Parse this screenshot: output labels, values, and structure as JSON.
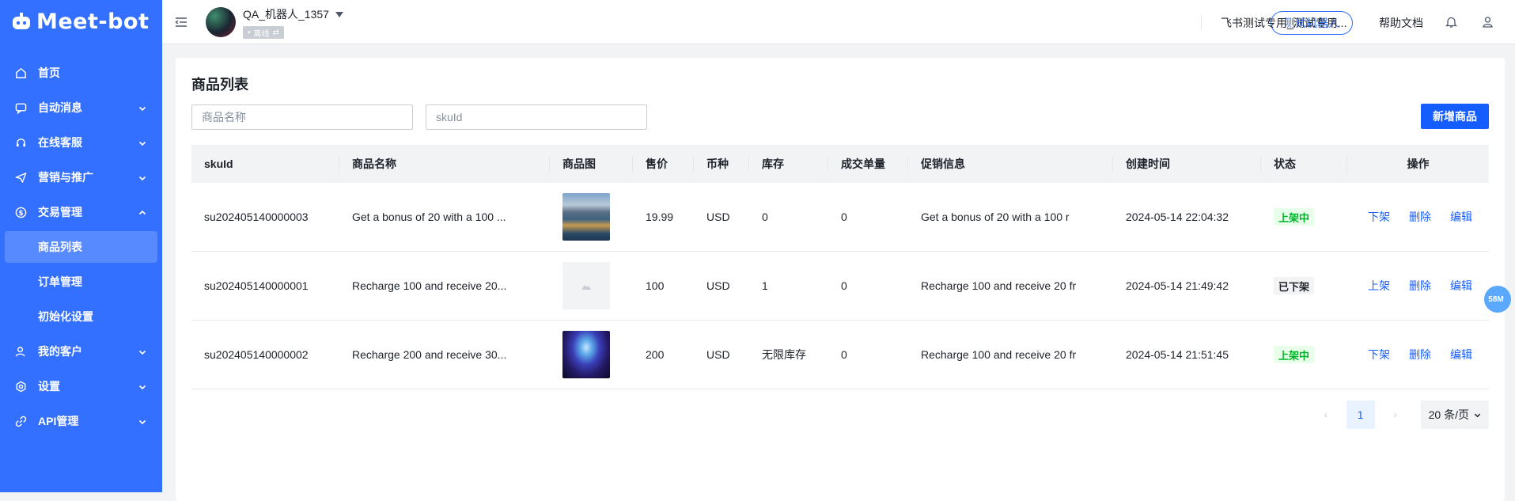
{
  "app": {
    "logo_text": "Meet-bot"
  },
  "nav": {
    "home": "首页",
    "auto_message": "自动消息",
    "online_service": "在线客服",
    "marketing": "营销与推广",
    "trade": "交易管理",
    "product_list": "商品列表",
    "order_manage": "订单管理",
    "init_settings": "初始化设置",
    "my_customers": "我的客户",
    "settings": "设置",
    "api_manage": "API管理"
  },
  "header": {
    "bot_name": "QA_机器人_1357",
    "status": "离线",
    "test_bot": "测试机器人",
    "workspace": "飞书测试专用_测试专用...",
    "help": "帮助文档"
  },
  "page": {
    "title": "商品列表",
    "name_placeholder": "商品名称",
    "sku_placeholder": "skuId",
    "add_button": "新增商品"
  },
  "table": {
    "columns": [
      "skuId",
      "商品名称",
      "商品图",
      "售价",
      "币种",
      "库存",
      "成交单量",
      "促销信息",
      "创建时间",
      "状态",
      "操作"
    ],
    "rows": [
      {
        "sku": "su202405140000003",
        "name": "Get a bonus of 20 with a 100 ...",
        "image": "mountain-lake",
        "price": "19.99",
        "currency": "USD",
        "stock": "0",
        "sold": "0",
        "promo": "Get a bonus of 20 with a 100 r",
        "created": "2024-05-14 22:04:32",
        "status": "上架中",
        "status_type": "on",
        "action1": "下架",
        "delete": "删除",
        "edit": "编辑"
      },
      {
        "sku": "su202405140000001",
        "name": "Recharge 100 and receive 20...",
        "image": "placeholder",
        "price": "100",
        "currency": "USD",
        "stock": "1",
        "sold": "0",
        "promo": "Recharge 100 and receive 20 fr",
        "created": "2024-05-14 21:49:42",
        "status": "已下架",
        "status_type": "off",
        "action1": "上架",
        "delete": "删除",
        "edit": "编辑"
      },
      {
        "sku": "su202405140000002",
        "name": "Recharge 200 and receive 30...",
        "image": "aurora",
        "price": "200",
        "currency": "USD",
        "stock": "无限库存",
        "sold": "0",
        "promo": "Recharge 100 and receive 20 fr",
        "created": "2024-05-14 21:51:45",
        "status": "上架中",
        "status_type": "on",
        "action1": "下架",
        "delete": "删除",
        "edit": "编辑"
      }
    ]
  },
  "pagination": {
    "current": "1",
    "page_size": "20 条/页"
  },
  "float_badge": "58M",
  "colors": {
    "primary": "#3370ff",
    "button": "#165dff",
    "on_green": "#00b42a"
  }
}
